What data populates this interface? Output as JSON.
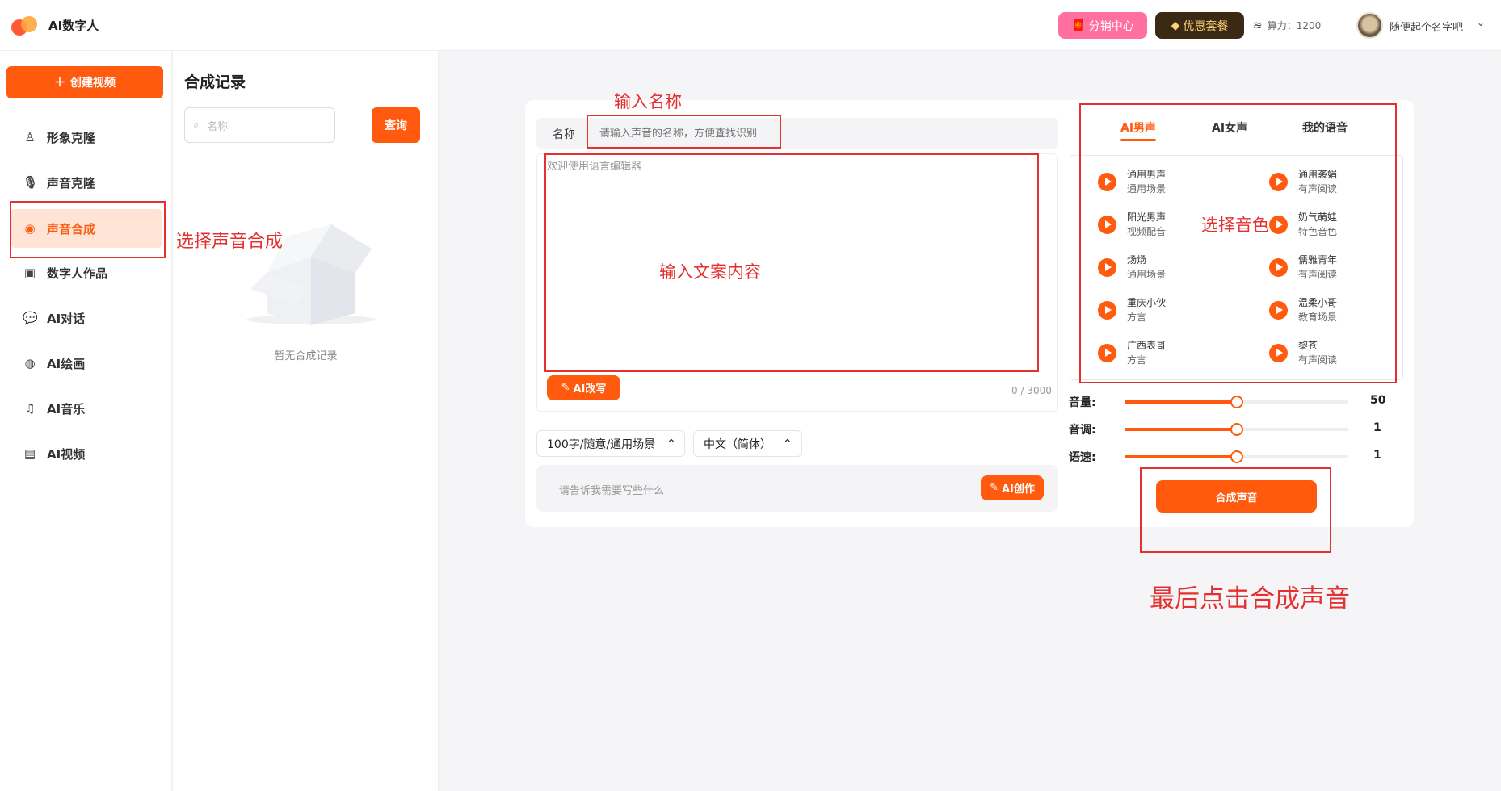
{
  "header": {
    "app_title": "AI数字人",
    "distribution_label": "分销中心",
    "deal_label": "优惠套餐",
    "compute_power": "算力：1200",
    "username": "随便起个名字吧"
  },
  "sidebar": {
    "create_label": "创建视频",
    "items": [
      {
        "label": "形象克隆",
        "icon": "person-icon"
      },
      {
        "label": "声音克隆",
        "icon": "microphone-icon"
      },
      {
        "label": "声音合成",
        "icon": "voice-icon",
        "active": true
      },
      {
        "label": "数字人作品",
        "icon": "video-icon"
      },
      {
        "label": "AI对话",
        "icon": "chat-icon"
      },
      {
        "label": "AI绘画",
        "icon": "palette-icon"
      },
      {
        "label": "AI音乐",
        "icon": "music-icon"
      },
      {
        "label": "AI视频",
        "icon": "film-icon"
      }
    ]
  },
  "records": {
    "title": "合成记录",
    "search_placeholder": "名称",
    "query_label": "查询",
    "empty_text": "暂无合成记录"
  },
  "editor": {
    "name_label": "名称",
    "name_placeholder": "请输入声音的名称，方便查找识别",
    "text_placeholder": "欢迎使用语言编辑器",
    "ai_rewrite_label": "AI改写",
    "char_count": "0 / 3000",
    "select_style": "100字/随意/通用场景",
    "select_language": "中文（简体）",
    "prompt_placeholder": "请告诉我需要写些什么",
    "ai_create_label": "AI创作"
  },
  "voice_panel": {
    "tabs": [
      "AI男声",
      "AI女声",
      "我的语音"
    ],
    "active_tab": "AI男声",
    "voices": [
      {
        "name": "通用男声",
        "tag": "通用场景"
      },
      {
        "name": "通用袭娟",
        "tag": "有声阅读"
      },
      {
        "name": "阳光男声",
        "tag": "视频配音"
      },
      {
        "name": "奶气萌娃",
        "tag": "特色音色"
      },
      {
        "name": "炀炀",
        "tag": "通用场景"
      },
      {
        "name": "儒雅青年",
        "tag": "有声阅读"
      },
      {
        "name": "重庆小伙",
        "tag": "方言"
      },
      {
        "name": "温柔小哥",
        "tag": "教育场景"
      },
      {
        "name": "广西表哥",
        "tag": "方言"
      },
      {
        "name": "黎苍",
        "tag": "有声阅读"
      }
    ],
    "sliders": [
      {
        "label": "音量:",
        "value": 50,
        "fraction": 0.5
      },
      {
        "label": "音调:",
        "value": 1,
        "fraction": 0.5
      },
      {
        "label": "语速:",
        "value": 1,
        "fraction": 0.5
      }
    ],
    "synthesize_label": "合成声音"
  },
  "annotations": {
    "name_hint": "输入名称",
    "select_hint": "选择声音合成",
    "content_hint": "输入文案内容",
    "voice_hint": "选择音色",
    "final_hint": "最后点击合成声音"
  },
  "colors": {
    "accent": "#ff5a0e",
    "annotation": "#e53030"
  }
}
